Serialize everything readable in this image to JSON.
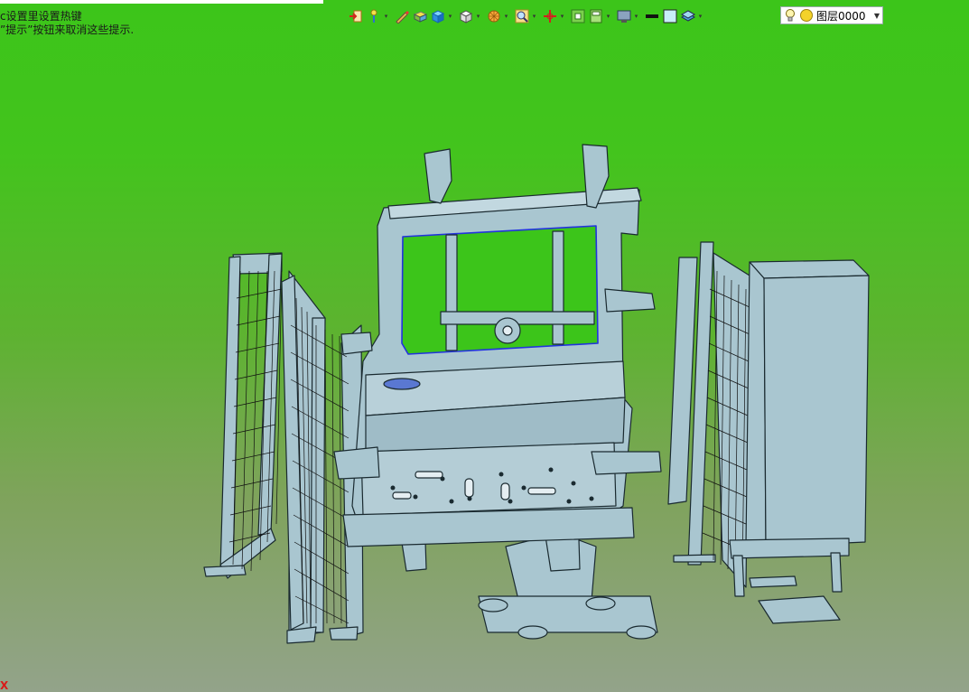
{
  "hints": {
    "line1": "с设置里设置热键",
    "line2": "”提示”按钮来取消这些提示."
  },
  "toolbar": {
    "items": [
      "exit-icon",
      "light-icon",
      "pen-icon",
      "box-edit-icon",
      "solid-icon",
      "view-cube-icon",
      "render-icon",
      "zoom-icon",
      "axis-icon",
      "fit-icon",
      "display-icon",
      "monitor-icon",
      "line-color-icon",
      "fill-color-icon",
      "layer-stack-icon"
    ]
  },
  "layer": {
    "name": "图层0000",
    "state_icons": [
      "bulb-icon",
      "sun-icon"
    ]
  },
  "axis_label": "X",
  "colors": {
    "bg_top": "#3cc51a",
    "bg_bottom": "#93a38a",
    "model_fill": "#a9c6d0",
    "model_line": "#1a2a30",
    "window_outline": "#2233dd"
  }
}
